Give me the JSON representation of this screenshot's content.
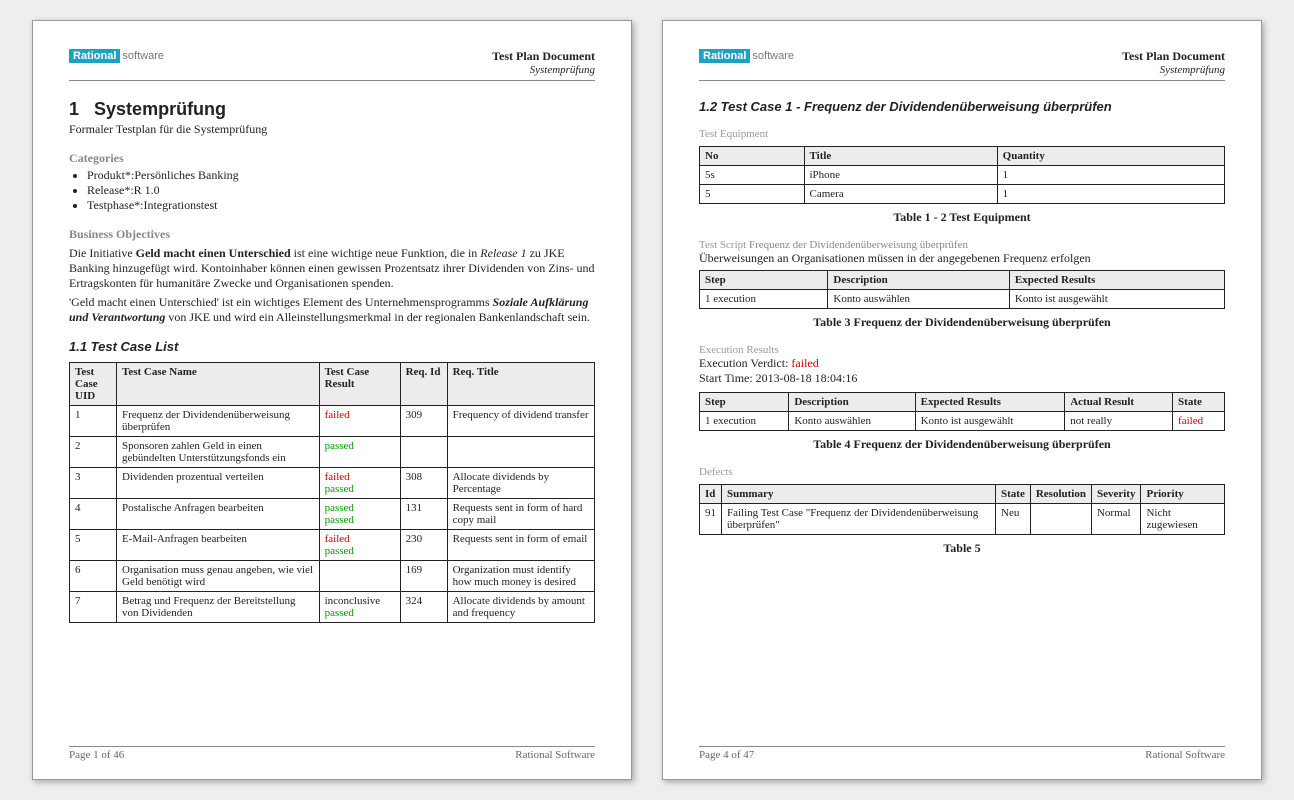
{
  "logo": {
    "brand": "Rational",
    "suffix": "software"
  },
  "header": {
    "doc_title": "Test Plan Document",
    "doc_subtitle": "Systemprüfung"
  },
  "page1": {
    "h1_num": "1",
    "h1_title": "Systemprüfung",
    "h1_sub": "Formaler Testplan für die Systemprüfung",
    "cat_label": "Categories",
    "categories": [
      "Produkt*:Persönliches Banking",
      "Release*:R 1.0",
      "Testphase*:Integrationstest"
    ],
    "obj_label": "Business Objectives",
    "obj_p1a": "Die Initiative ",
    "obj_p1b": "Geld macht einen Unterschied",
    "obj_p1c": " ist eine wichtige neue Funktion, die in ",
    "obj_p1d": "Release 1",
    "obj_p1e": " zu JKE Banking hinzugefügt wird. Kontoinhaber können einen gewissen Prozentsatz ihrer Dividenden von Zins- und Ertragskonten für humanitäre Zwecke und Organisationen spenden.",
    "obj_p2a": "'Geld macht einen Unterschied' ist ein wichtiges Element des Unternehmensprogramms ",
    "obj_p2b": "Soziale Aufklärung und Verantwortung",
    "obj_p2c": " von JKE und wird ein Alleinstellungsmerkmal in der regionalen Bankenlandschaft sein.",
    "tcl_title": "1.1  Test Case List",
    "tcl_cols": [
      "Test Case UID",
      "Test Case Name",
      "Test Case Result",
      "Req. Id",
      "Req. Title"
    ],
    "tcl_rows": [
      {
        "uid": "1",
        "name": "Frequenz der Dividendenüberweisung überprüfen",
        "results": [
          {
            "t": "failed",
            "c": "red"
          }
        ],
        "rid": "309",
        "rt": "Frequency of dividend transfer"
      },
      {
        "uid": "2",
        "name": "Sponsoren zahlen Geld in einen gebündelten Unterstützungsfonds ein",
        "results": [
          {
            "t": "passed",
            "c": "green"
          }
        ],
        "rid": "",
        "rt": ""
      },
      {
        "uid": "3",
        "name": "Dividenden prozentual verteilen",
        "results": [
          {
            "t": "failed",
            "c": "red"
          },
          {
            "t": "passed",
            "c": "green"
          }
        ],
        "rid": "308",
        "rt": "Allocate dividends by Percentage"
      },
      {
        "uid": "4",
        "name": "Postalische Anfragen bearbeiten",
        "results": [
          {
            "t": "passed",
            "c": "green"
          },
          {
            "t": "passed",
            "c": "green"
          }
        ],
        "rid": "131",
        "rt": "Requests sent in form of hard copy mail"
      },
      {
        "uid": "5",
        "name": "E-Mail-Anfragen bearbeiten",
        "results": [
          {
            "t": "failed",
            "c": "red"
          },
          {
            "t": "passed",
            "c": "green"
          }
        ],
        "rid": "230",
        "rt": "Requests sent in form of email"
      },
      {
        "uid": "6",
        "name": "Organisation muss genau angeben, wie viel Geld benötigt wird",
        "results": [],
        "rid": "169",
        "rt": "Organization must identify how much money is desired"
      },
      {
        "uid": "7",
        "name": "Betrag und Frequenz der Bereitstellung von Dividenden",
        "results": [
          {
            "t": "inconclusive",
            "c": ""
          },
          {
            "t": "passed",
            "c": "green"
          }
        ],
        "rid": "324",
        "rt": "Allocate dividends by amount and frequency"
      }
    ],
    "footer_left": "Page 1 of  46",
    "footer_right": "Rational Software"
  },
  "page2": {
    "h3": "1.2  Test Case 1 - Frequenz der Dividendenüberweisung überprüfen",
    "eq_label": "Test Equipment",
    "eq_cols": [
      "No",
      "Title",
      "Quantity"
    ],
    "eq_rows": [
      {
        "no": "5s",
        "title": "iPhone",
        "qty": "1"
      },
      {
        "no": "5",
        "title": "Camera",
        "qty": "1"
      }
    ],
    "eq_caption": "Table 1 - 2 Test Equipment",
    "ts_label_a": "Test Script ",
    "ts_label_b": "Frequenz der Dividendenüberweisung überprüfen",
    "ts_desc": "Überweisungen an Organisationen müssen in der angegebenen Frequenz erfolgen",
    "ts_cols": [
      "Step",
      "Description",
      "Expected Results"
    ],
    "ts_rows": [
      {
        "s": "1 execution",
        "d": "Konto auswählen",
        "e": "Konto ist ausgewählt"
      }
    ],
    "ts_caption": "Table 3 Frequenz der Dividendenüberweisung überprüfen",
    "er_label": "Execution Results",
    "er_verdict_l": "Execution Verdict: ",
    "er_verdict_v": "failed",
    "er_start": "Start Time: 2013-08-18 18:04:16",
    "er_cols": [
      "Step",
      "Description",
      "Expected Results",
      "Actual Result",
      "State"
    ],
    "er_rows": [
      {
        "s": "1 execution",
        "d": "Konto auswählen",
        "e": "Konto ist ausgewählt",
        "a": "not really",
        "st": "failed"
      }
    ],
    "er_caption": "Table 4 Frequenz der Dividendenüberweisung überprüfen",
    "df_label": "Defects",
    "df_cols": [
      "Id",
      "Summary",
      "State",
      "Resolution",
      "Severity",
      "Priority"
    ],
    "df_rows": [
      {
        "id": "91",
        "sum": "Failing Test Case \"Frequenz der Dividendenüberweisung überprüfen\"",
        "st": "Neu",
        "res": "",
        "sev": "Normal",
        "pr": "Nicht zugewiesen"
      }
    ],
    "df_caption": "Table 5",
    "footer_left": "Page 4 of  47",
    "footer_right": "Rational Software"
  }
}
